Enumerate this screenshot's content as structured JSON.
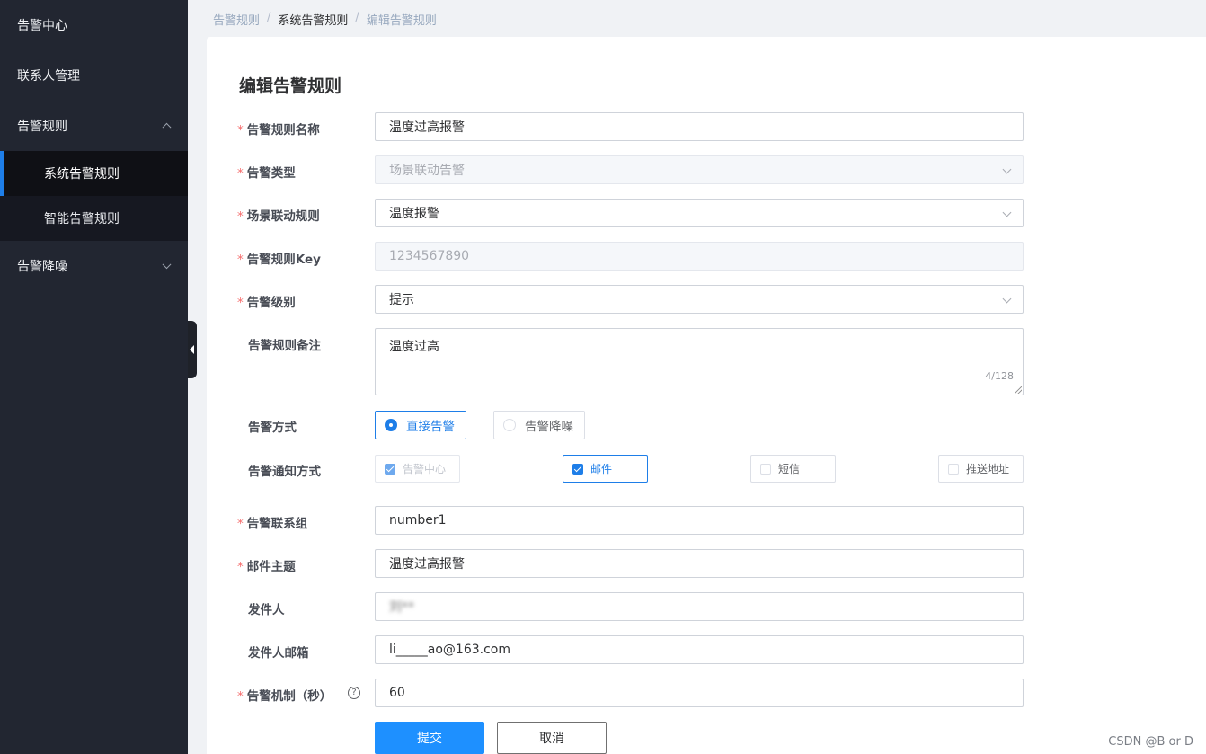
{
  "sidebar": {
    "items": [
      {
        "label": "告警中心"
      },
      {
        "label": "联系人管理"
      },
      {
        "label": "告警规则",
        "children": [
          {
            "label": "系统告警规则",
            "active": true
          },
          {
            "label": "智能告警规则"
          }
        ]
      },
      {
        "label": "告警降噪"
      }
    ]
  },
  "breadcrumb": [
    "告警规则",
    "/",
    "系统告警规则",
    "/",
    "编辑告警规则"
  ],
  "form": {
    "title": "编辑告警规则",
    "required_mark": "*",
    "rule_name": {
      "label": "告警规则名称",
      "value": "温度过高报警"
    },
    "alarm_type": {
      "label": "告警类型",
      "value": "场景联动告警"
    },
    "scene_rule": {
      "label": "场景联动规则",
      "value": "温度报警"
    },
    "rule_key": {
      "label": "告警规则Key",
      "value": "1234567890"
    },
    "level": {
      "label": "告警级别",
      "value": "提示"
    },
    "remark": {
      "label": "告警规则备注",
      "value": "温度过高",
      "counter": "4/128"
    },
    "method": {
      "label": "告警方式",
      "options": [
        "直接告警",
        "告警降噪"
      ],
      "selected": "直接告警"
    },
    "notify": {
      "label": "告警通知方式",
      "options": [
        "告警中心",
        "邮件",
        "短信",
        "推送地址"
      ]
    },
    "contact_group": {
      "label": "告警联系组",
      "value": "number1"
    },
    "mail_subject": {
      "label": "邮件主题",
      "value": "温度过高报警"
    },
    "sender": {
      "label": "发件人",
      "value": "刘**"
    },
    "sender_email": {
      "label": "发件人邮箱",
      "value": "li_____ao@163.com"
    },
    "mechanism": {
      "label": "告警机制（秒）",
      "value": "60",
      "help": "?"
    },
    "submit_label": "提交",
    "cancel_label": "取消"
  },
  "watermark": "CSDN @B    or    D",
  "colors": {
    "primary": "#1e7ee8",
    "sidebar_bg": "#222631",
    "required": "#f56c6c"
  }
}
